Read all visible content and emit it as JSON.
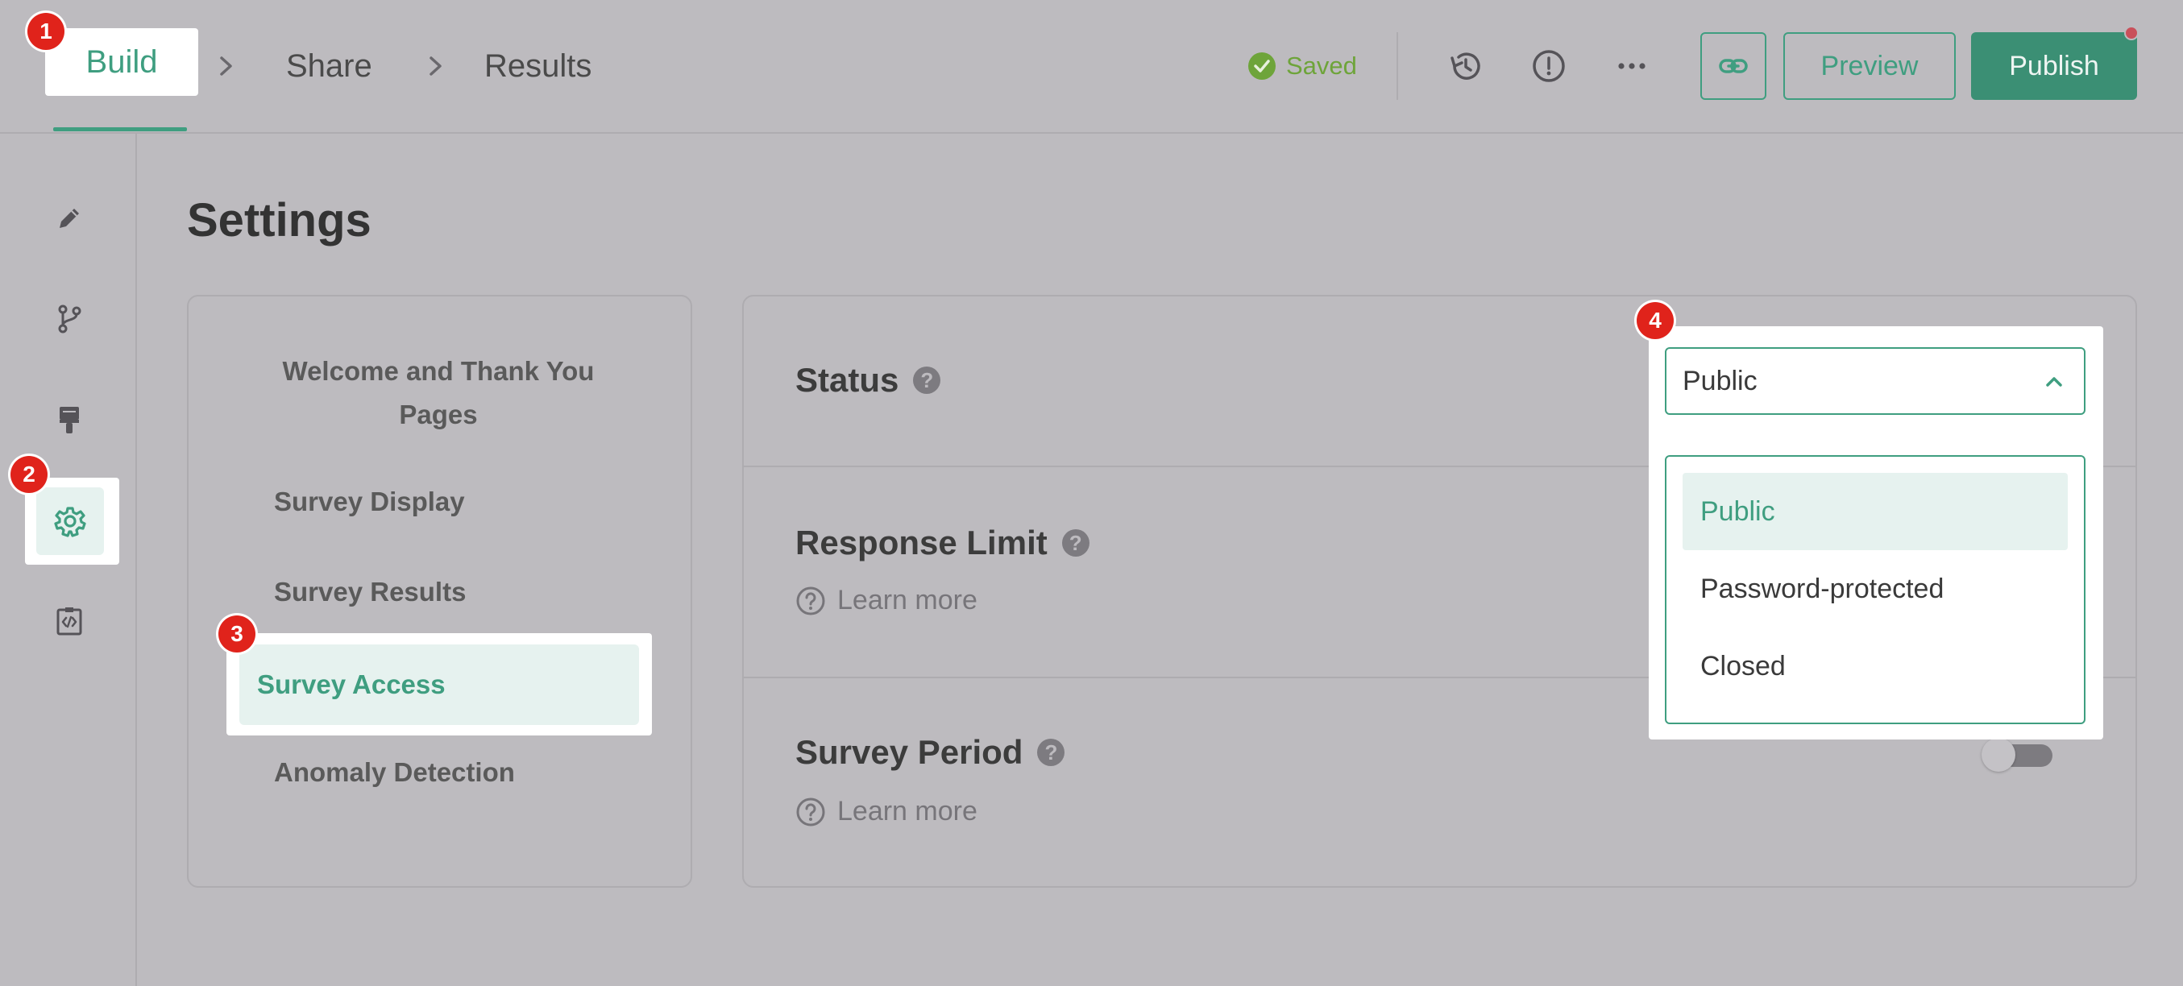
{
  "breadcrumb": {
    "build": "Build",
    "share": "Share",
    "results": "Results"
  },
  "header": {
    "saved_status": "Saved",
    "preview_label": "Preview",
    "publish_label": "Publish",
    "icons": [
      "history-icon",
      "alert-circle-icon",
      "more-horizontal-icon",
      "link-icon"
    ]
  },
  "rail": {
    "icons": [
      "pencil-icon",
      "branch-icon",
      "paint-brush-icon",
      "gear-icon",
      "code-icon"
    ]
  },
  "page": {
    "title": "Settings"
  },
  "settings_nav": {
    "items": [
      "Welcome and Thank You Pages",
      "Survey Display",
      "Survey Results",
      "Survey Access",
      "Anomaly Detection"
    ]
  },
  "content": {
    "status_label": "Status",
    "response_limit_label": "Response Limit",
    "survey_period_label": "Survey Period",
    "learn_more": "Learn more",
    "help_glyph": "?"
  },
  "status_dropdown": {
    "selected": "Public",
    "options": [
      "Public",
      "Password-protected",
      "Closed"
    ]
  },
  "badges": [
    "1",
    "2",
    "3",
    "4"
  ],
  "colors": {
    "accent": "#3f9e80",
    "publish": "#3b8f74",
    "saved": "#6ea43a",
    "badge": "#e0231b",
    "selected_bg": "#e6f2ef"
  }
}
